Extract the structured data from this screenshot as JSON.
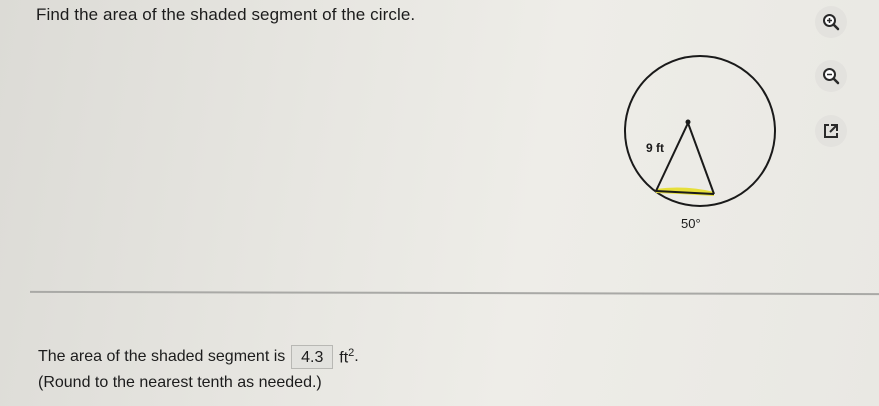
{
  "question": {
    "text": "Find the area of the shaded segment of the circle."
  },
  "figure": {
    "radius_label": "9 ft",
    "angle_label": "50°",
    "segment_color": "#e6df3a"
  },
  "toolbar": {
    "zoom_in_icon": "zoom-in-icon",
    "zoom_out_icon": "zoom-out-icon",
    "popout_icon": "popout-icon"
  },
  "answer": {
    "prefix": "The area of the shaded segment is",
    "value": "4.3",
    "unit": "ft",
    "unit_exponent": "2",
    "suffix": ".",
    "note": "(Round to the nearest tenth as needed.)"
  }
}
